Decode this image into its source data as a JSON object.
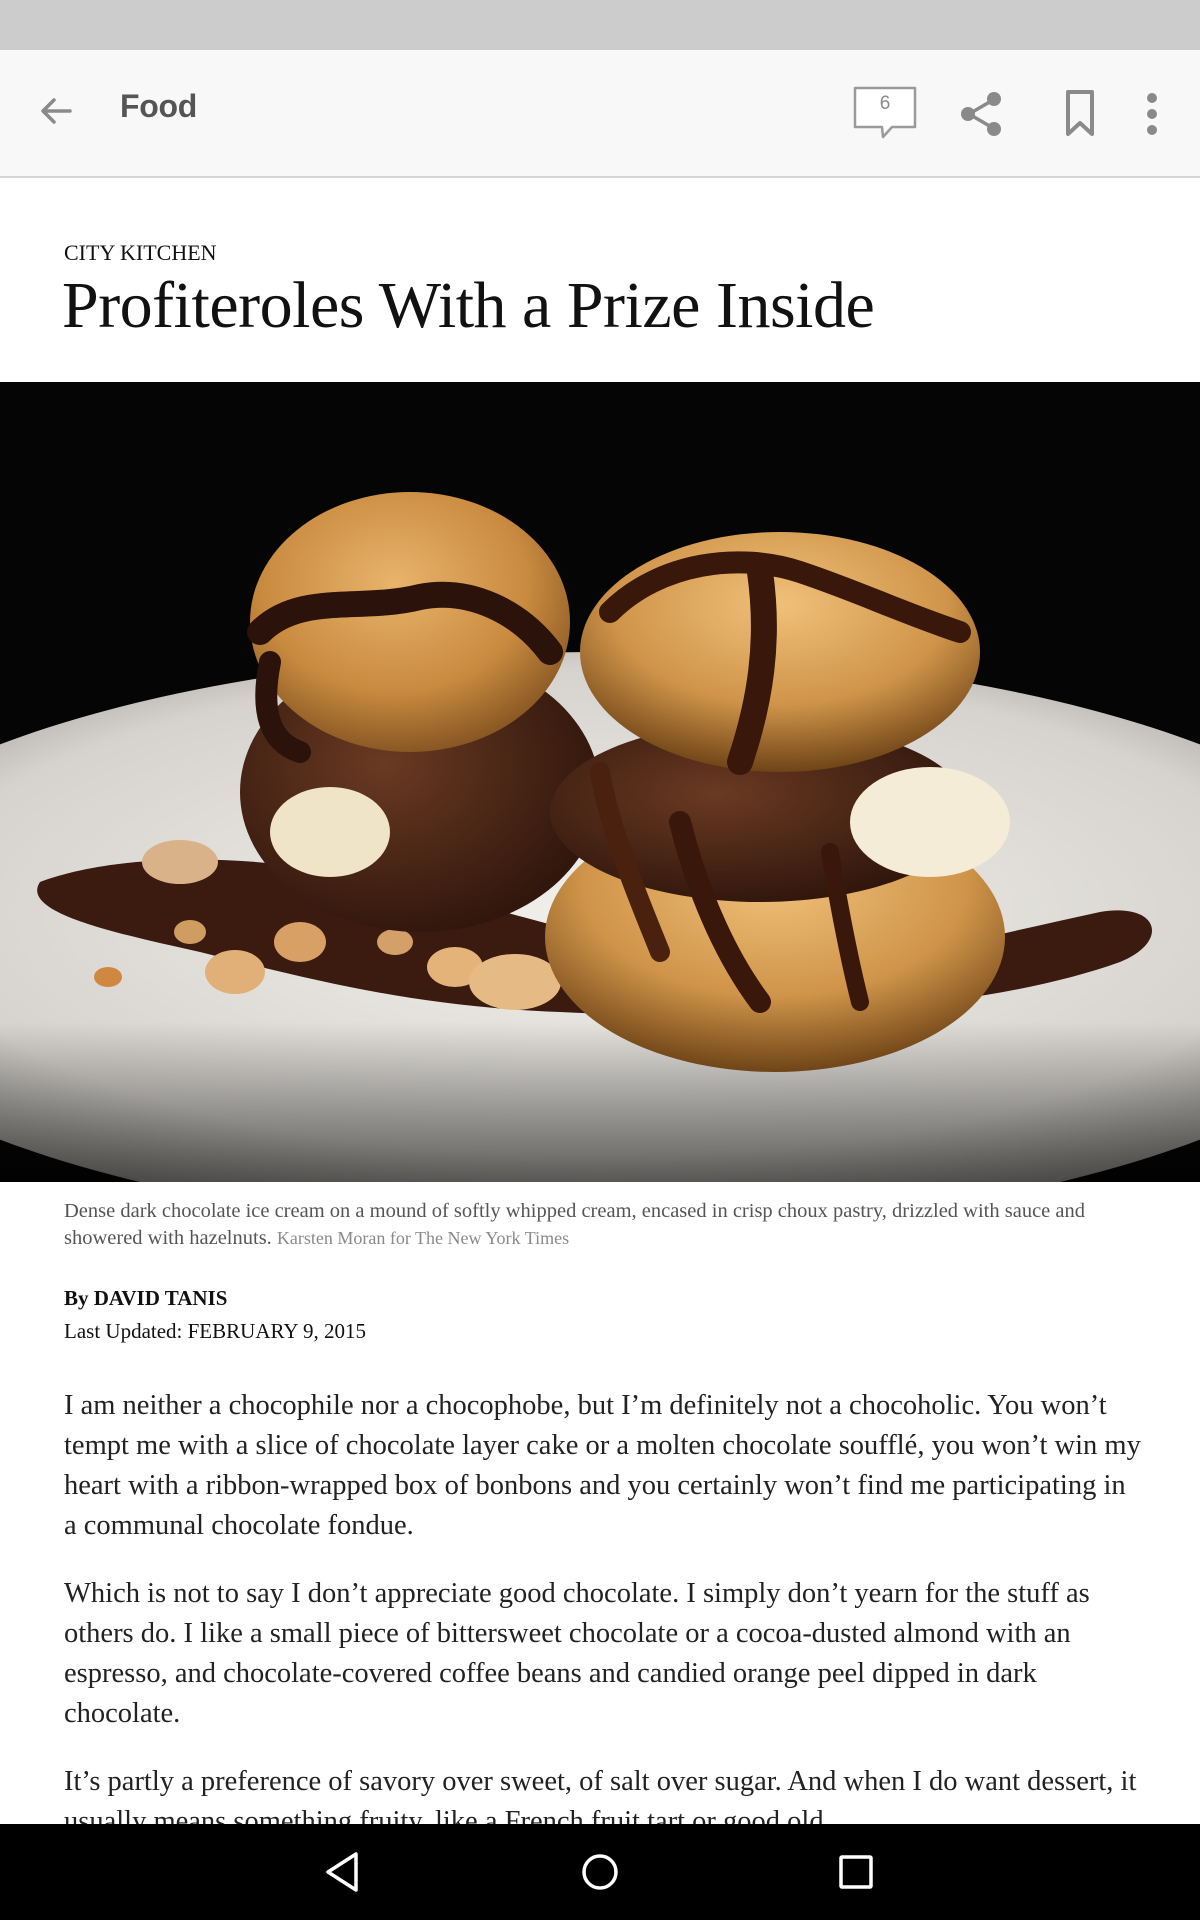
{
  "app_bar": {
    "title": "Food",
    "comment_count": "6",
    "icons": [
      "back-arrow-icon",
      "comment-icon",
      "share-icon",
      "bookmark-icon",
      "more-vert-icon"
    ]
  },
  "article": {
    "kicker": "CITY KITCHEN",
    "headline": "Profiteroles With a Prize Inside",
    "caption": "Dense dark chocolate ice cream on a mound of softly whipped cream, encased in crisp choux pastry, drizzled with sauce and showered with hazelnuts.",
    "photo_credit": "Karsten Moran for The New York Times",
    "byline": "By DAVID TANIS",
    "updated": "Last Updated: FEBRUARY 9, 2015",
    "paragraphs": [
      "I am neither a chocophile nor a chocophobe, but I’m definitely not a chocoholic. You won’t tempt me with a slice of chocolate layer cake or a molten chocolate soufflé, you won’t win my heart with a ribbon-wrapped box of bonbons and you certainly won’t find me participating in a communal chocolate fondue.",
      "Which is not to say I don’t appreciate good chocolate. I simply don’t yearn for the stuff as others do. I like a small piece of bittersweet chocolate or a cocoa-dusted almond with an espresso, and chocolate-covered coffee beans and candied orange peel dipped in dark chocolate.",
      "It’s partly a preference of savory over sweet, of salt over sugar. And when I do want dessert, it usually means something fruity, like a French fruit tart or good old"
    ]
  },
  "nav_bar": {
    "icons": [
      "nav-back-icon",
      "nav-home-icon",
      "nav-recents-icon"
    ]
  },
  "colors": {
    "app_bar_bg": "#f8f8f8",
    "status_bar_bg": "#cccccc",
    "icon_gray": "#8a8a8a",
    "text_dark": "#111111"
  }
}
